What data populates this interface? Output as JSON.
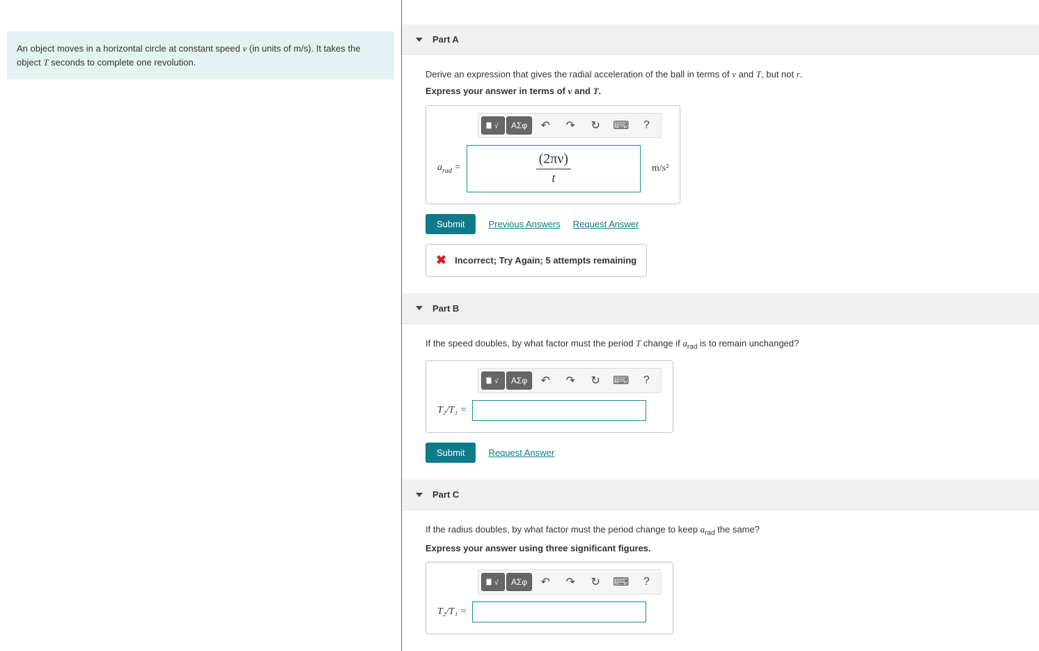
{
  "problem": {
    "text_pre": "An object moves in a horizontal circle at constant speed ",
    "v": "v",
    "text_units": " (in units of ",
    "units": "m/s",
    "text_mid": "). It takes the object ",
    "T": "T",
    "text_post": " seconds to complete one revolution."
  },
  "partA": {
    "title": "Part A",
    "prompt_pre": "Derive an expression that gives the radial acceleration of the ball in terms of ",
    "v": "v",
    "and": " and ",
    "T": "T",
    "prompt_mid": ", but not ",
    "r": "r",
    "period": ".",
    "bold_pre": "Express your answer in terms of ",
    "eq_label": "a",
    "eq_sub": "rad",
    "equals": " = ",
    "input_top": "(2πν)",
    "input_bot": "t",
    "units": "m/s²",
    "submit": "Submit",
    "prev": "Previous Answers",
    "req": "Request Answer",
    "feedback": "Incorrect; Try Again; 5 attempts remaining"
  },
  "partB": {
    "title": "Part B",
    "prompt_pre": "If the speed doubles, by what factor must the period ",
    "T": "T",
    "prompt_mid": " change if ",
    "a": "a",
    "a_sub": "rad",
    "prompt_post": " is to remain unchanged?",
    "eq_label": "T₂/T₁",
    "equals": " = ",
    "submit": "Submit",
    "req": "Request Answer"
  },
  "partC": {
    "title": "Part C",
    "prompt_pre": "If the radius doubles, by what factor must the period change to keep ",
    "a": "a",
    "a_sub": "rad",
    "prompt_post": " the same?",
    "bold": "Express your answer using three significant figures.",
    "eq_label": "T₂/T₁",
    "equals": " = "
  },
  "toolbar": {
    "greek": "ΑΣφ",
    "help": "?"
  }
}
